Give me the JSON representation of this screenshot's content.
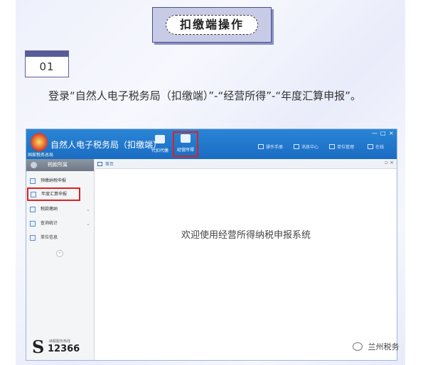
{
  "header": {
    "title": "扣缴端操作"
  },
  "step": {
    "number": "01"
  },
  "instruction": "登录“自然人电子税务局（扣缴端）”-“经营所得”-“年度汇算申报”。",
  "app": {
    "title": "自然人电子税务局（扣缴端）",
    "logo_caption": "国家税务总局",
    "toolbar": [
      {
        "label": "代扣代缴",
        "icon": "document-icon"
      },
      {
        "label": "经营所得",
        "icon": "coins-icon",
        "highlighted": true
      }
    ],
    "right_tools": [
      {
        "label": "操作手册",
        "icon": "manual-icon"
      },
      {
        "label": "消息中心",
        "icon": "mail-icon"
      },
      {
        "label": "单位管理",
        "icon": "company-icon"
      },
      {
        "label": "在线",
        "icon": "online-icon"
      }
    ],
    "window_controls": [
      "—",
      "□",
      "×"
    ],
    "sidebar": {
      "header": "税款所属",
      "items": [
        {
          "label": "预缴纳税申报",
          "expandable": false
        },
        {
          "label": "年度汇算申报",
          "expandable": false,
          "highlighted": true
        },
        {
          "label": "税款缴纳",
          "expandable": true
        },
        {
          "label": "查询统计",
          "expandable": true
        },
        {
          "label": "单位信息",
          "expandable": false
        }
      ],
      "hotline_label": "纳税服务热线",
      "hotline_number": "12366"
    },
    "tab": {
      "label": "首页"
    },
    "welcome": "欢迎使用经营所得纳税申报系统"
  },
  "watermark": "兰州税务",
  "colors": {
    "titlebar": "#1f78cc",
    "highlight": "#e02020",
    "accent": "#585c9a"
  }
}
